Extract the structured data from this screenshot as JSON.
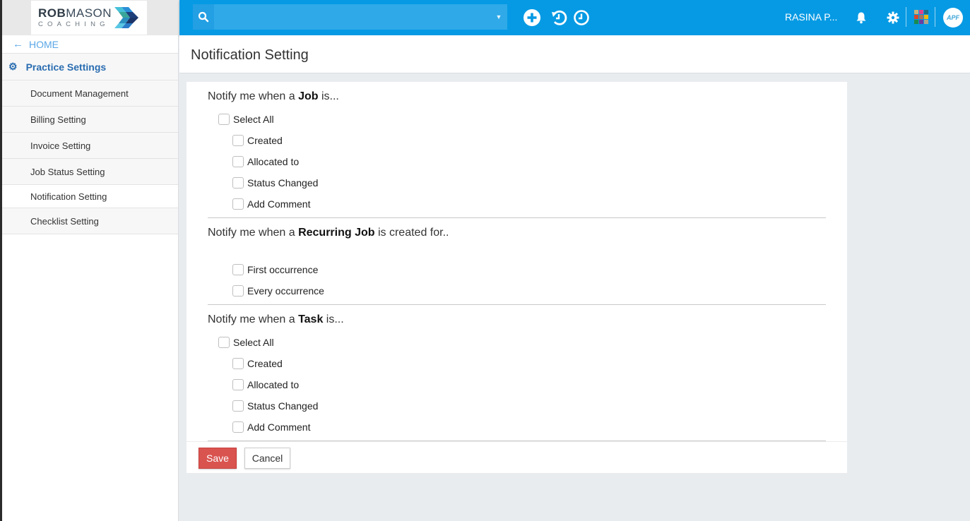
{
  "brand": {
    "logo_main_bold": "ROB",
    "logo_main_rest": "MASON",
    "logo_sub": "COACHING"
  },
  "sidebar": {
    "home_label": "HOME",
    "section_label": "Practice Settings",
    "items": [
      {
        "label": "Document Management",
        "active": false
      },
      {
        "label": "Billing Setting",
        "active": false
      },
      {
        "label": "Invoice Setting",
        "active": false
      },
      {
        "label": "Job Status Setting",
        "active": false
      },
      {
        "label": "Notification Setting",
        "active": true
      },
      {
        "label": "Checklist Setting",
        "active": false
      }
    ]
  },
  "header": {
    "search_value": "",
    "search_placeholder": "",
    "user_name": "RASINA P...",
    "avatar_text": "APF",
    "icons": [
      "search-icon",
      "dropdown-caret-icon",
      "add-circle-icon",
      "history-icon",
      "clock-icon",
      "bell-icon",
      "gear-icon",
      "apps-grid-icon",
      "avatar"
    ],
    "apps_grid_colors": [
      "#c7b27a",
      "#e0418e",
      "#1d6f8a",
      "#d9472b",
      "#a9745a",
      "#f2b90f",
      "#1b8a4f",
      "#6a3ea1",
      "#b0a48a"
    ],
    "bar_color": "#069ae4"
  },
  "page": {
    "title": "Notification Setting"
  },
  "sections": [
    {
      "prefix": "Notify me when a ",
      "bold": "Job",
      "suffix": " is...",
      "select_all": "Select All",
      "options": [
        {
          "label": "Created",
          "checked": false
        },
        {
          "label": "Allocated to",
          "checked": false
        },
        {
          "label": "Status Changed",
          "checked": false
        },
        {
          "label": "Add Comment",
          "checked": false
        }
      ]
    },
    {
      "prefix": "Notify me when a ",
      "bold": "Recurring Job",
      "suffix": " is created for..",
      "options": [
        {
          "label": "First occurrence",
          "checked": false
        },
        {
          "label": "Every occurrence",
          "checked": false
        }
      ]
    },
    {
      "prefix": "Notify me when a ",
      "bold": "Task",
      "suffix": " is...",
      "select_all": "Select All",
      "options": [
        {
          "label": "Created",
          "checked": false
        },
        {
          "label": "Allocated to",
          "checked": false
        },
        {
          "label": "Status Changed",
          "checked": false
        },
        {
          "label": "Add Comment",
          "checked": false
        }
      ]
    }
  ],
  "actions": {
    "save_label": "Save",
    "cancel_label": "Cancel",
    "save_color": "#d9534f"
  }
}
